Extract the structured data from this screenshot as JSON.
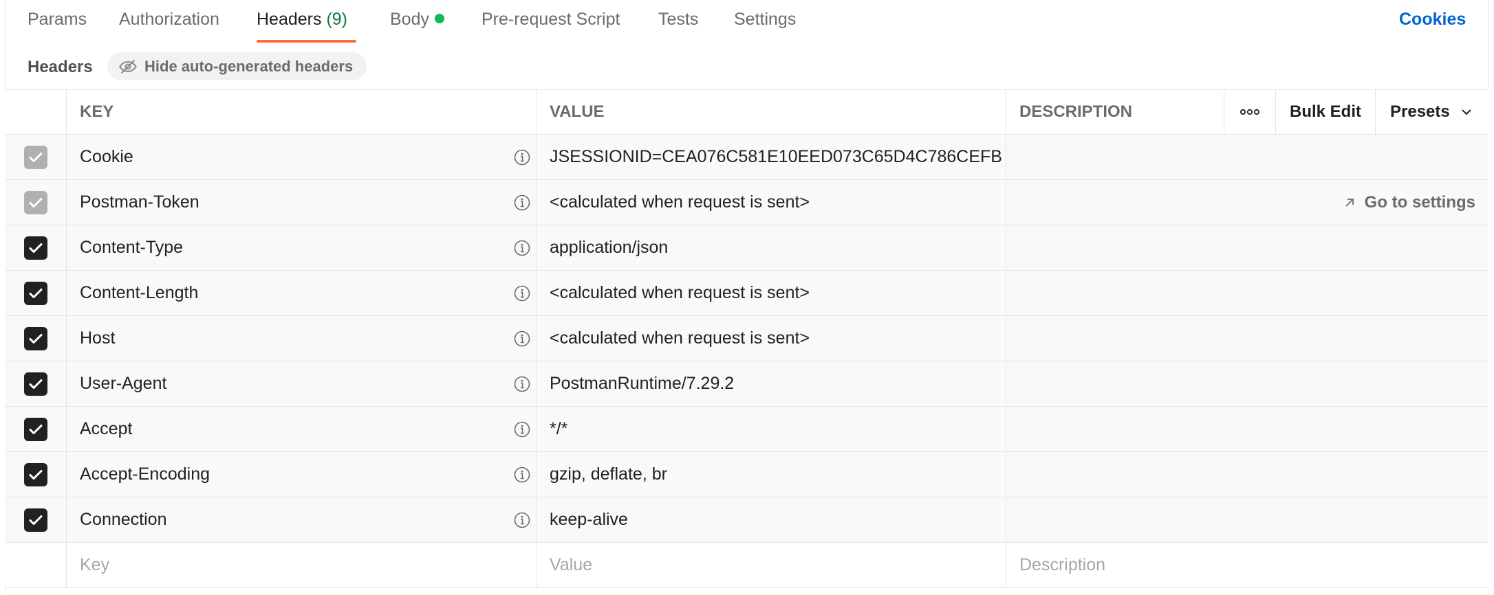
{
  "tabs": {
    "params": "Params",
    "authorization": "Authorization",
    "headers": "Headers",
    "headers_count": "(9)",
    "body": "Body",
    "pre_request": "Pre-request Script",
    "tests": "Tests",
    "settings": "Settings"
  },
  "cookies_link": "Cookies",
  "section": {
    "title": "Headers",
    "hide_button": "Hide auto-generated headers"
  },
  "table": {
    "columns": {
      "key": "KEY",
      "value": "VALUE",
      "description": "DESCRIPTION"
    },
    "bulk_edit": "Bulk Edit",
    "presets": "Presets",
    "rows": [
      {
        "key": "Cookie",
        "value": "JSESSIONID=CEA076C581E10EED073C65D4C786CEFB",
        "state": "disabled"
      },
      {
        "key": "Postman-Token",
        "value": "<calculated when request is sent>",
        "state": "disabled"
      },
      {
        "key": "Content-Type",
        "value": "application/json",
        "state": "on"
      },
      {
        "key": "Content-Length",
        "value": "<calculated when request is sent>",
        "state": "on"
      },
      {
        "key": "Host",
        "value": "<calculated when request is sent>",
        "state": "on"
      },
      {
        "key": "User-Agent",
        "value": "PostmanRuntime/7.29.2",
        "state": "on"
      },
      {
        "key": "Accept",
        "value": "*/*",
        "state": "on"
      },
      {
        "key": "Accept-Encoding",
        "value": "gzip, deflate, br",
        "state": "on"
      },
      {
        "key": "Connection",
        "value": "keep-alive",
        "state": "on"
      }
    ],
    "go_to_settings": "Go to settings",
    "new_row": {
      "key_placeholder": "Key",
      "value_placeholder": "Value",
      "description_placeholder": "Description"
    }
  },
  "colors": {
    "accent": "#ff6c37",
    "count_green": "#0b7a3b",
    "body_dot": "#0cbb52",
    "link_blue": "#0265d2"
  }
}
